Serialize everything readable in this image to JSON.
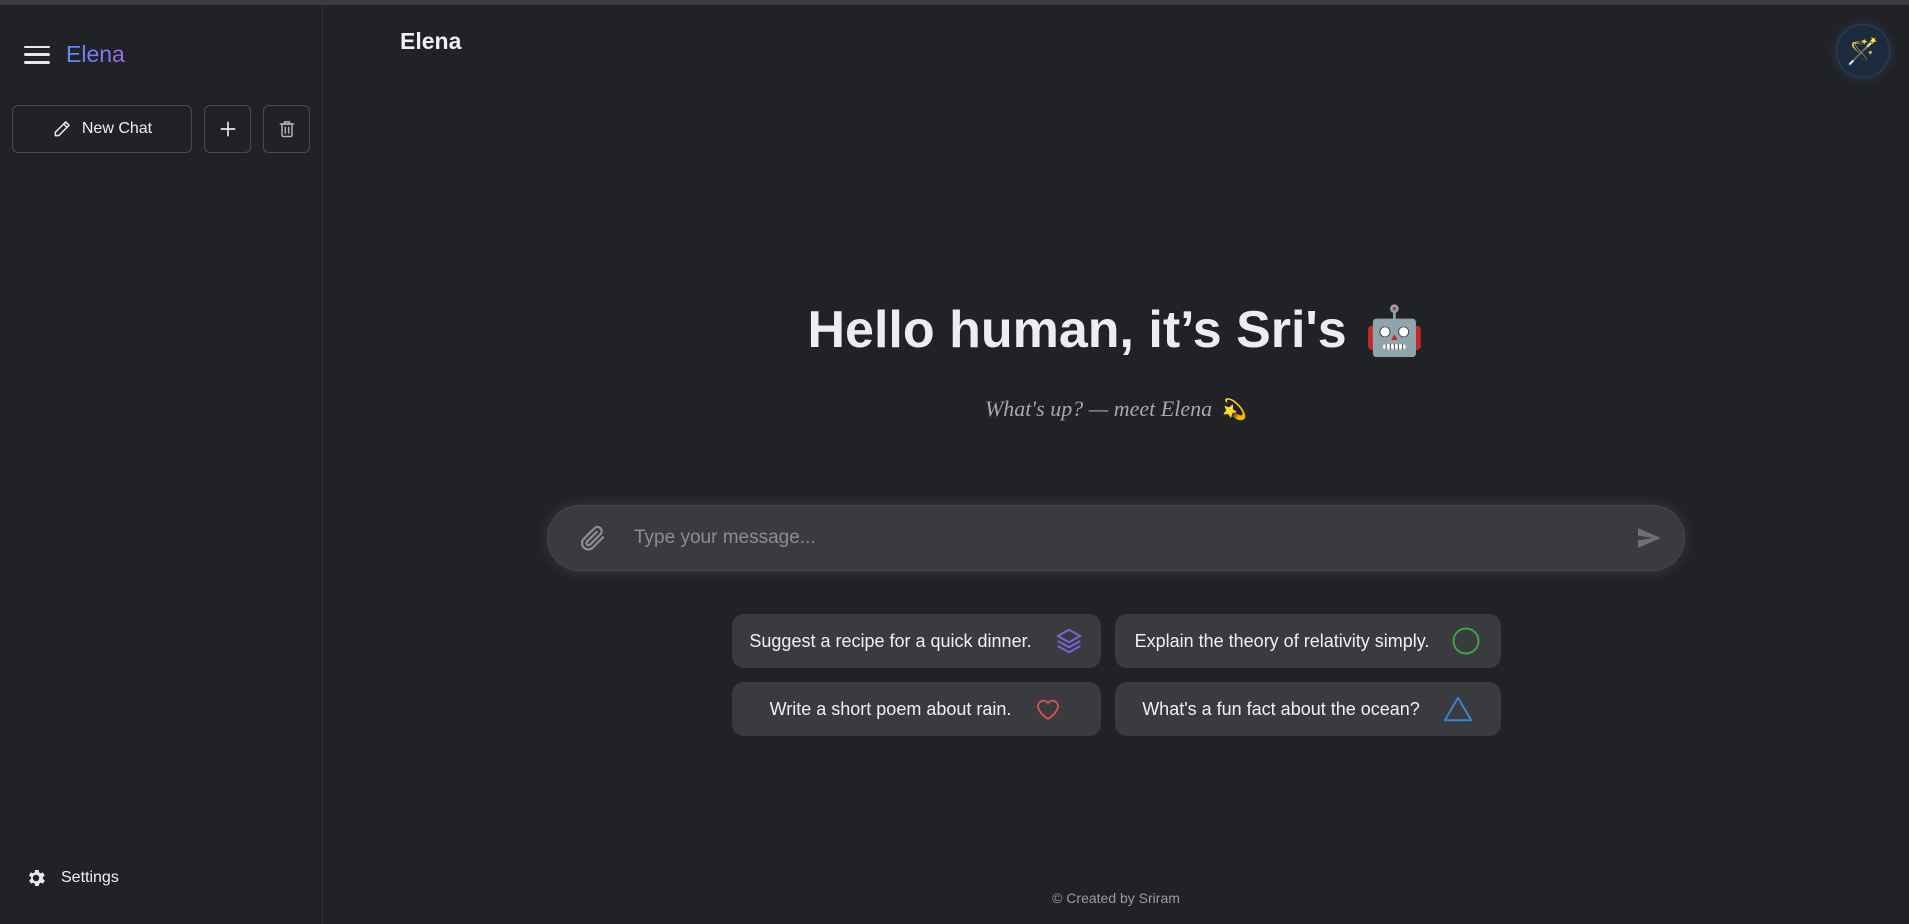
{
  "sidebar": {
    "brand": "Elena",
    "new_chat_label": "New Chat",
    "settings_label": "Settings"
  },
  "header": {
    "title": "Elena"
  },
  "hero": {
    "title": "Hello human, it’s Sri's",
    "title_emoji": "🤖",
    "subtitle": "What's up? — meet Elena",
    "subtitle_emoji": "💫"
  },
  "composer": {
    "placeholder": "Type your message..."
  },
  "suggestions": [
    {
      "label": "Suggest a recipe for a quick dinner.",
      "icon": "layers-icon",
      "color": "#7b63d6"
    },
    {
      "label": "Explain the theory of relativity simply.",
      "icon": "circle-icon",
      "color": "#3fa44a"
    },
    {
      "label": "Write a short poem about rain.",
      "icon": "heart-icon",
      "color": "#d2534f"
    },
    {
      "label": "What's a fun fact about the ocean?",
      "icon": "triangle-icon",
      "color": "#3b82d6"
    }
  ],
  "footer": {
    "credit": "© Created by Sriram"
  },
  "colors": {
    "background": "#212226",
    "accent_start": "#5b8df2",
    "accent_end": "#9b6bf0"
  }
}
